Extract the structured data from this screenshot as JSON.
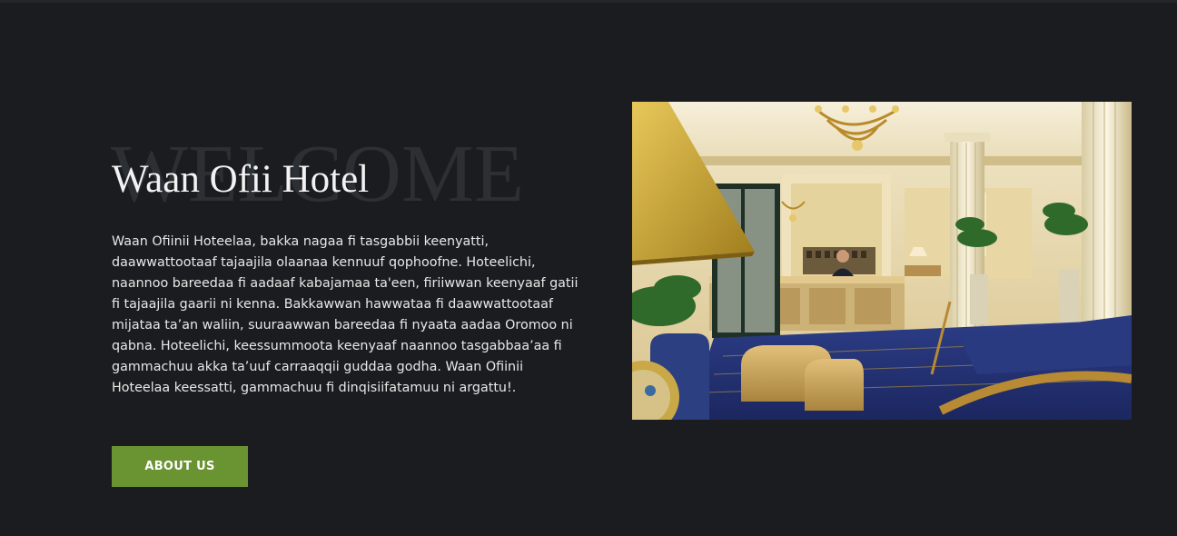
{
  "hero": {
    "watermark": "WELCOME",
    "title": "Waan Ofii Hotel",
    "description": "Waan Ofiinii Hoteelaa, bakka nagaa fi tasgabbii keenyatti, daawwattootaaf tajaajila olaanaa kennuuf qophoofne. Hoteelichi, naannoo bareedaa fi aadaaf kabajamaa ta'een, firiiwwan keenyaaf gatii fi tajaajila gaarii ni kenna. Bakkawwan hawwataa fi daawwattootaaf mijataa ta’an waliin, suuraawwan bareedaa fi nyaata aadaa Oromoo ni qabna. Hoteelichi, keessummoota keenyaaf naannoo tasgabbaa’aa fi gammachuu akka ta’uuf carraaqqii guddaa godha. Waan Ofiinii Hoteelaa keessatti, gammachuu fi dinqisiifatamuu ni argattu!.",
    "button_label": "ABOUT US"
  },
  "image": {
    "subject": "hotel-lobby-photo"
  },
  "colors": {
    "background": "#1a1c1f",
    "accent": "#6a9331",
    "watermark": "#2c2f33"
  }
}
